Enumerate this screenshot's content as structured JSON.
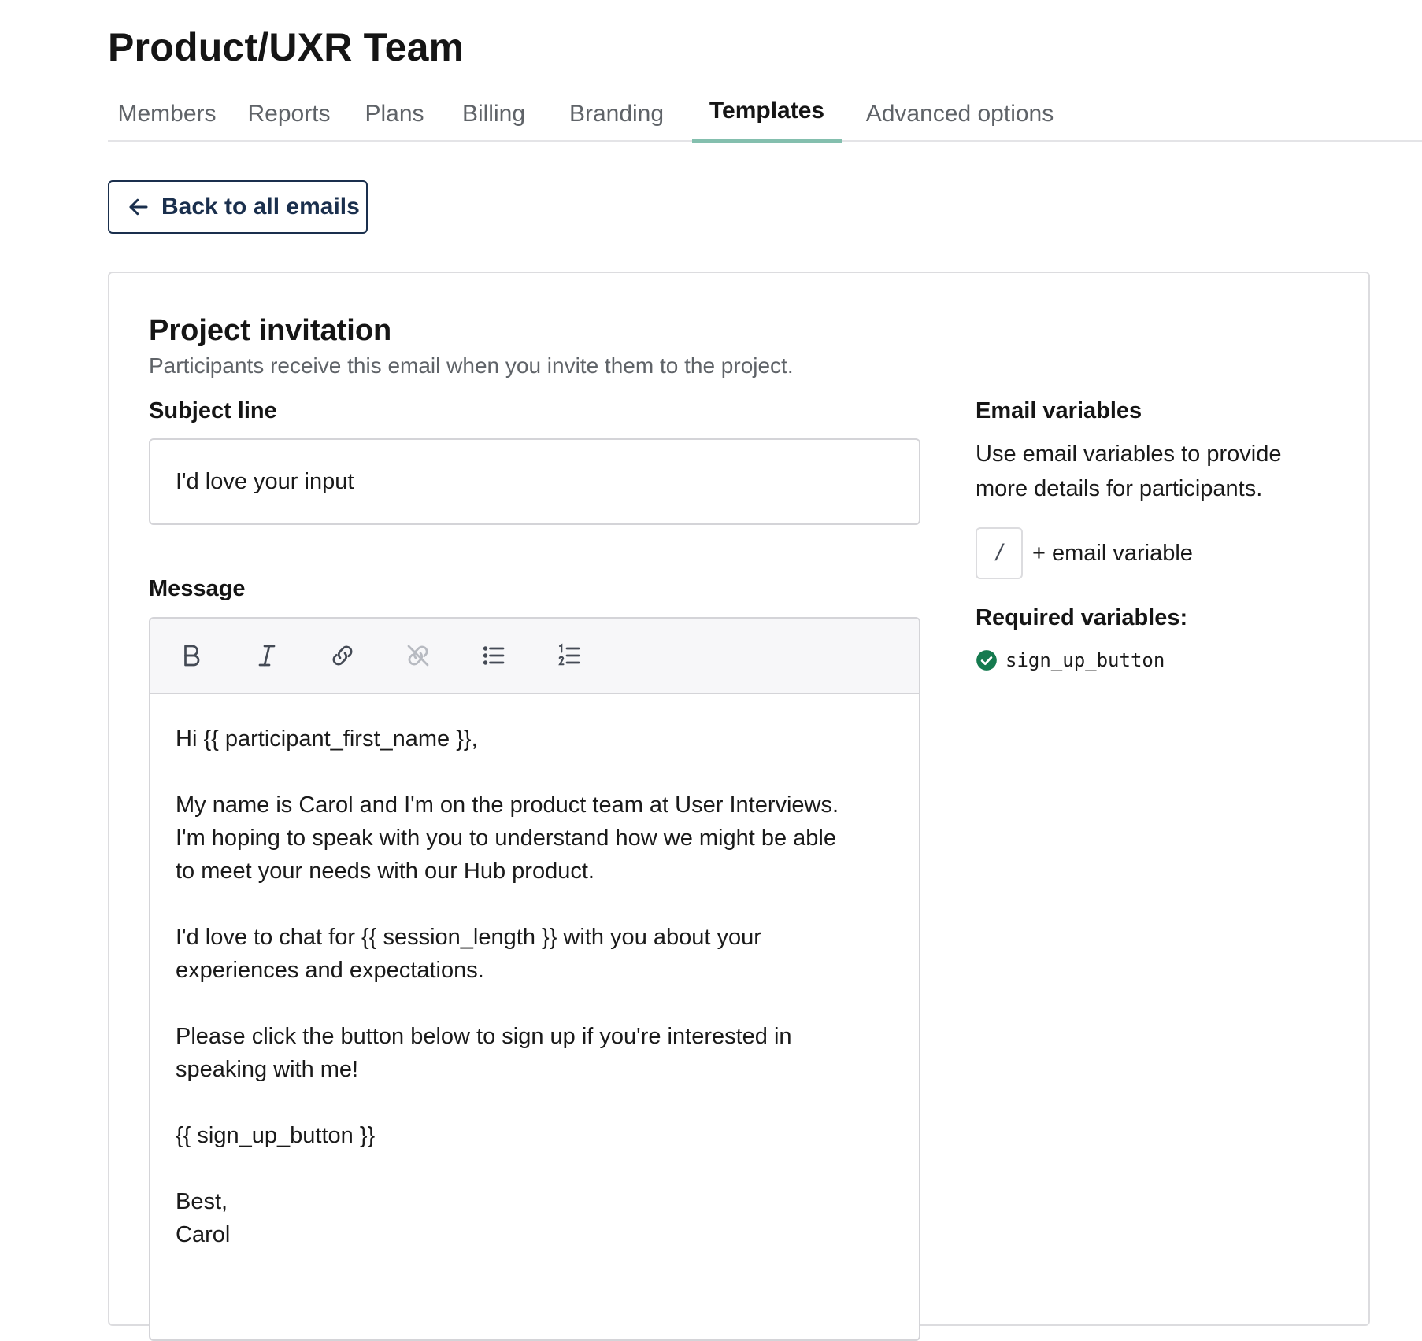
{
  "page": {
    "title": "Product/UXR Team"
  },
  "tabs": [
    {
      "label": "Members",
      "active": false
    },
    {
      "label": "Reports",
      "active": false
    },
    {
      "label": "Plans",
      "active": false
    },
    {
      "label": "Billing",
      "active": false
    },
    {
      "label": "Branding",
      "active": false
    },
    {
      "label": "Templates",
      "active": true
    },
    {
      "label": "Advanced options",
      "active": false
    }
  ],
  "back_button": {
    "label": "Back to all emails",
    "icon": "arrow-left-icon"
  },
  "email": {
    "title": "Project invitation",
    "description": "Participants receive this email when you invite them to the project.",
    "subject_label": "Subject line",
    "subject_value": "I'd love your input",
    "message_label": "Message",
    "toolbar": [
      {
        "name": "bold-icon",
        "enabled": true
      },
      {
        "name": "italic-icon",
        "enabled": true
      },
      {
        "name": "link-icon",
        "enabled": true
      },
      {
        "name": "unlink-icon",
        "enabled": false
      },
      {
        "name": "bulleted-list-icon",
        "enabled": true
      },
      {
        "name": "numbered-list-icon",
        "enabled": true
      }
    ],
    "message_paragraphs": [
      "Hi {{ participant_first_name }},",
      "My name is Carol and I'm on the product team at User Interviews.\nI'm hoping to speak with you to understand how we might be able\nto meet your needs with our Hub product.",
      "I'd love to chat for {{ session_length }} with you about your\nexperiences and expectations.",
      "Please click the button below to sign up if you're interested in\nspeaking with me!",
      "{{ sign_up_button }}",
      "Best,\nCarol"
    ]
  },
  "variables": {
    "heading": "Email variables",
    "description": "Use email variables to provide more details for participants.",
    "slash_key": "/",
    "add_label": "+ email variable",
    "required_heading": "Required variables:",
    "required": [
      {
        "name": "sign_up_button",
        "satisfied": true,
        "icon": "check-circle-icon"
      }
    ]
  },
  "colors": {
    "accent_tab_underline": "#84bfae",
    "back_button": "#1a2f4d",
    "success": "#157a4f"
  }
}
